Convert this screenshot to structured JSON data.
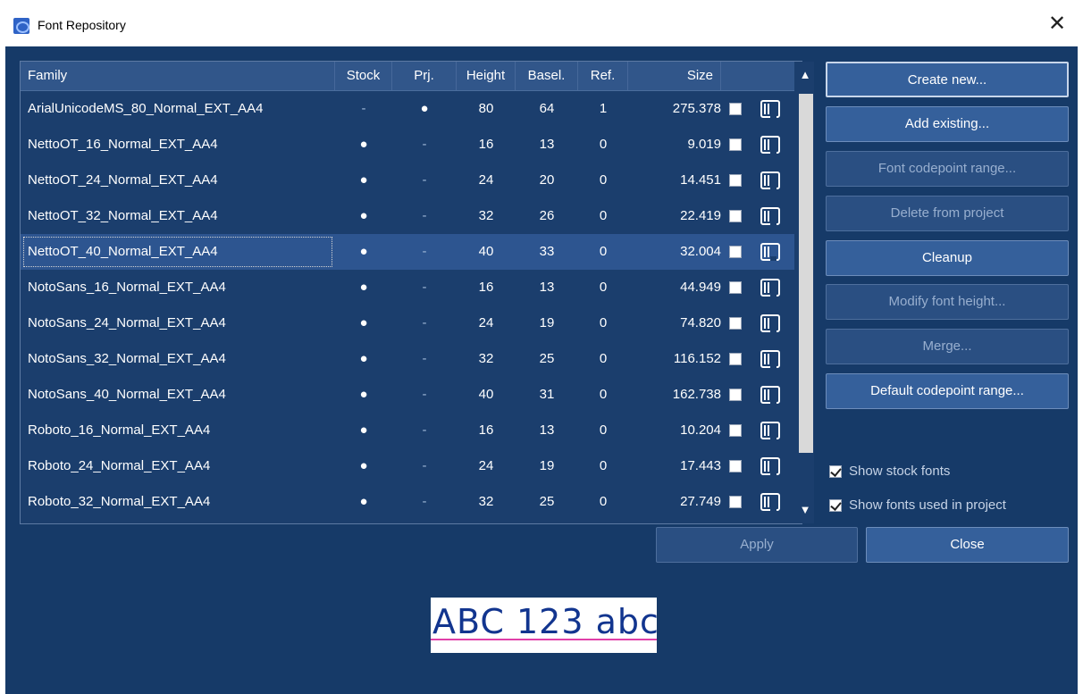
{
  "window": {
    "title": "Font Repository"
  },
  "table": {
    "columns": [
      "Family",
      "Stock",
      "Prj.",
      "Height",
      "Basel.",
      "Ref.",
      "Size"
    ],
    "rows": [
      {
        "family": "ArialUnicodeMS_80_Normal_EXT_AA4",
        "stock": "-",
        "prj": "●",
        "height": "80",
        "basel": "64",
        "ref": "1",
        "size": "275.378"
      },
      {
        "family": "NettoOT_16_Normal_EXT_AA4",
        "stock": "●",
        "prj": "-",
        "height": "16",
        "basel": "13",
        "ref": "0",
        "size": "9.019"
      },
      {
        "family": "NettoOT_24_Normal_EXT_AA4",
        "stock": "●",
        "prj": "-",
        "height": "24",
        "basel": "20",
        "ref": "0",
        "size": "14.451"
      },
      {
        "family": "NettoOT_32_Normal_EXT_AA4",
        "stock": "●",
        "prj": "-",
        "height": "32",
        "basel": "26",
        "ref": "0",
        "size": "22.419"
      },
      {
        "family": "NettoOT_40_Normal_EXT_AA4",
        "stock": "●",
        "prj": "-",
        "height": "40",
        "basel": "33",
        "ref": "0",
        "size": "32.004",
        "selected": true
      },
      {
        "family": "NotoSans_16_Normal_EXT_AA4",
        "stock": "●",
        "prj": "-",
        "height": "16",
        "basel": "13",
        "ref": "0",
        "size": "44.949"
      },
      {
        "family": "NotoSans_24_Normal_EXT_AA4",
        "stock": "●",
        "prj": "-",
        "height": "24",
        "basel": "19",
        "ref": "0",
        "size": "74.820"
      },
      {
        "family": "NotoSans_32_Normal_EXT_AA4",
        "stock": "●",
        "prj": "-",
        "height": "32",
        "basel": "25",
        "ref": "0",
        "size": "116.152"
      },
      {
        "family": "NotoSans_40_Normal_EXT_AA4",
        "stock": "●",
        "prj": "-",
        "height": "40",
        "basel": "31",
        "ref": "0",
        "size": "162.738"
      },
      {
        "family": "Roboto_16_Normal_EXT_AA4",
        "stock": "●",
        "prj": "-",
        "height": "16",
        "basel": "13",
        "ref": "0",
        "size": "10.204"
      },
      {
        "family": "Roboto_24_Normal_EXT_AA4",
        "stock": "●",
        "prj": "-",
        "height": "24",
        "basel": "19",
        "ref": "0",
        "size": "17.443"
      },
      {
        "family": "Roboto_32_Normal_EXT_AA4",
        "stock": "●",
        "prj": "-",
        "height": "32",
        "basel": "25",
        "ref": "0",
        "size": "27.749"
      }
    ]
  },
  "actions": {
    "create_new": "Create new...",
    "add_existing": "Add existing...",
    "font_codepoint_range": "Font codepoint range...",
    "delete_from_project": "Delete from project",
    "cleanup": "Cleanup",
    "modify_font_height": "Modify font height...",
    "merge": "Merge...",
    "default_codepoint_range": "Default codepoint range..."
  },
  "options": {
    "show_stock_fonts": "Show stock fonts",
    "show_fonts_used_in_project": "Show fonts used in project"
  },
  "footer": {
    "apply": "Apply",
    "close": "Close"
  },
  "preview": {
    "sample_text": "ABC 123 abc"
  },
  "icons": {
    "app": "font-repository-app-icon",
    "close": "close-icon",
    "row_action": "sd-card-icon",
    "scroll_up": "scroll-up-arrow-icon",
    "scroll_down": "scroll-down-arrow-icon"
  },
  "colors": {
    "background": "#163a68",
    "selection": "#2d5590",
    "header": "#31568a",
    "baseline": "#e03fa8"
  }
}
